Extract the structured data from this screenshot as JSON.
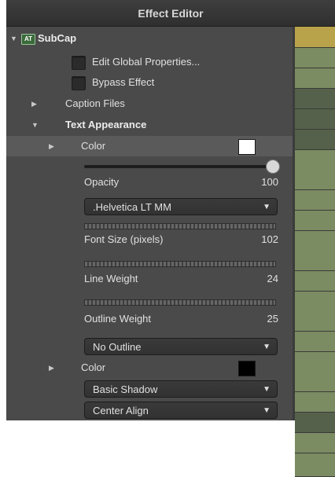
{
  "window": {
    "title": "Effect Editor"
  },
  "effect": {
    "badge_text": "AT",
    "name": "SubCap"
  },
  "options": {
    "edit_global": "Edit Global Properties...",
    "bypass": "Bypass Effect"
  },
  "caption_files": {
    "label": "Caption Files"
  },
  "text_appearance": {
    "label": "Text Appearance"
  },
  "color_1": {
    "label": "Color",
    "swatch": "#ffffff"
  },
  "opacity": {
    "label": "Opacity",
    "value": "100",
    "fraction": 1.0
  },
  "font": {
    "selected": ".Helvetica LT MM"
  },
  "font_size": {
    "label": "Font Size (pixels)",
    "value": "102"
  },
  "line_weight": {
    "label": "Line Weight",
    "value": "24"
  },
  "outline_weight": {
    "label": "Outline Weight",
    "value": "25"
  },
  "outline_mode": {
    "selected": "No Outline"
  },
  "color_2": {
    "label": "Color",
    "swatch": "#000000"
  },
  "shadow": {
    "selected": "Basic Shadow"
  },
  "align": {
    "selected": "Center Align"
  },
  "timeline_colors": [
    "#b9a34a",
    "#7b8b62",
    "#7b8b62",
    "#55614a",
    "#55614a",
    "#55614a",
    "#7b8b62",
    "#7b8b62",
    "#7b8b62",
    "#7b8b62",
    "#7b8b62",
    "#7b8b62",
    "#7b8b62",
    "#7b8b62",
    "#7b8b62",
    "#55614a",
    "#7b8b62",
    "#7b8b62"
  ]
}
